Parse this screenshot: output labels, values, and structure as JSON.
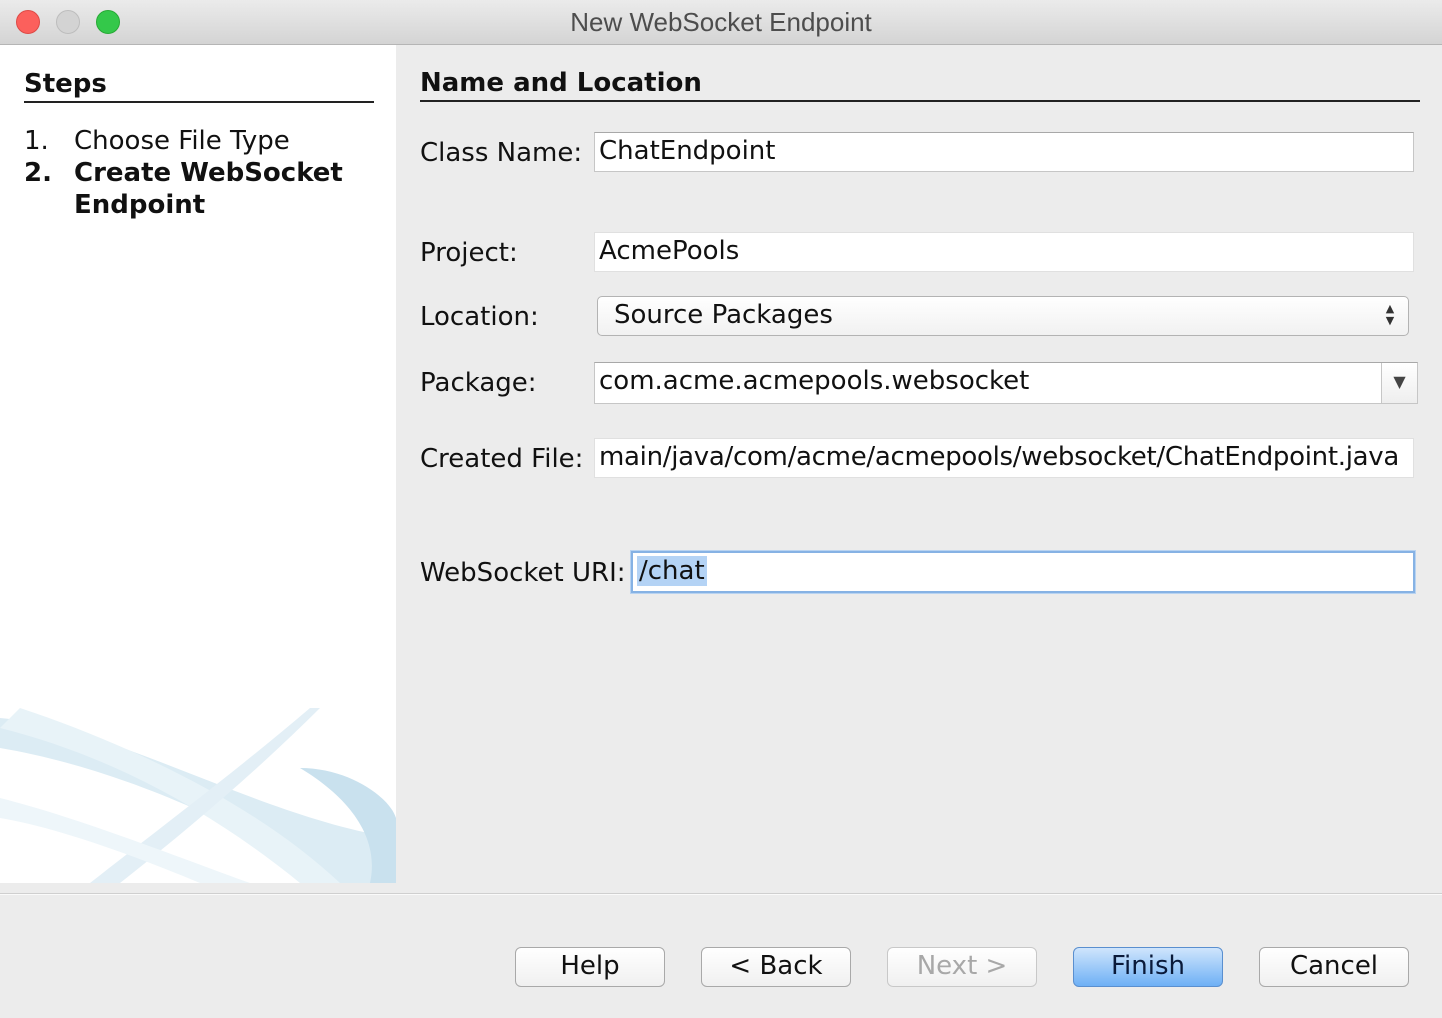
{
  "window": {
    "title": "New WebSocket Endpoint"
  },
  "steps": {
    "heading": "Steps",
    "items": [
      {
        "number": "1.",
        "label": "Choose File Type",
        "current": false
      },
      {
        "number": "2.",
        "label": "Create WebSocket Endpoint",
        "current": true
      }
    ]
  },
  "form": {
    "heading": "Name and Location",
    "class_name": {
      "label": "Class Name:",
      "value": "ChatEndpoint"
    },
    "project": {
      "label": "Project:",
      "value": "AcmePools"
    },
    "location": {
      "label": "Location:",
      "value": "Source Packages"
    },
    "package": {
      "label": "Package:",
      "value": "com.acme.acmepools.websocket"
    },
    "created_file": {
      "label": "Created File:",
      "value": "main/java/com/acme/acmepools/websocket/ChatEndpoint.java"
    },
    "websocket_uri": {
      "label": "WebSocket URI:",
      "value": "/chat"
    }
  },
  "buttons": {
    "help": "Help",
    "back": "< Back",
    "next": "Next >",
    "finish": "Finish",
    "cancel": "Cancel"
  },
  "icons": {
    "close": "close-window-icon",
    "minimize": "minimize-window-icon",
    "zoom": "zoom-window-icon",
    "location_updown": "updown-arrows-icon",
    "package_dropdown": "chevron-down-icon"
  },
  "colors": {
    "primary_button": "#6eb0f5",
    "focus_ring": "#86b2e4",
    "text_selection": "#b4d3f5"
  }
}
